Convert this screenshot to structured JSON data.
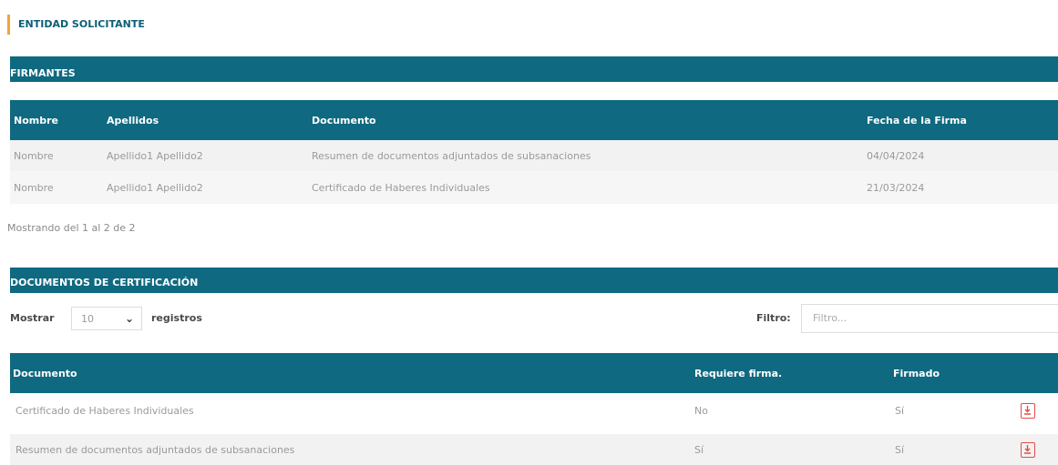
{
  "entity": {
    "title": "ENTIDAD SOLICITANTE"
  },
  "firmantes": {
    "title": "FIRMANTES",
    "columns": [
      "Nombre",
      "Apellidos",
      "Documento",
      "Fecha de la Firma"
    ],
    "rows": [
      {
        "nombre": "Nombre",
        "apellidos": "Apellido1 Apellido2",
        "documento": "Resumen de documentos adjuntados de subsanaciones",
        "fecha": "04/04/2024"
      },
      {
        "nombre": "Nombre",
        "apellidos": "Apellido1 Apellido2",
        "documento": "Certificado de Haberes Individuales",
        "fecha": "21/03/2024"
      }
    ],
    "info": "Mostrando del 1 al 2 de 2"
  },
  "certificacion": {
    "title": "DOCUMENTOS DE CERTIFICACIÓN",
    "show_label": "Mostrar",
    "page_size": "10",
    "records_label": "registros",
    "filter_label": "Filtro:",
    "filter_placeholder": "Filtro...",
    "columns": [
      "Documento",
      "Requiere firma.",
      "Firmado"
    ],
    "rows": [
      {
        "documento": "Certificado de Haberes Individuales",
        "requiere": "No",
        "firmado": "Sí"
      },
      {
        "documento": "Resumen de documentos adjuntados de subsanaciones",
        "requiere": "Sí",
        "firmado": "Sí"
      }
    ],
    "icon": "pdf-icon"
  },
  "colors": {
    "header_bg": "#0f6980",
    "accent": "#f2a33a",
    "pdf_red": "#e64a4a",
    "alt_row": "#f2f2f2"
  }
}
